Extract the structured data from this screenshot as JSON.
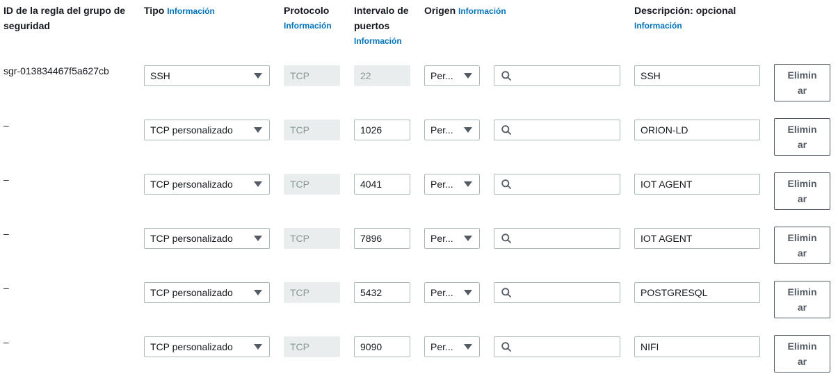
{
  "headers": {
    "rule_id": "ID de la regla del grupo de seguridad",
    "type": "Tipo",
    "protocol": "Protocolo",
    "port_range": "Intervalo de puertos",
    "source": "Origen",
    "description": "Descripción: opcional",
    "info_link": "Información"
  },
  "rows": [
    {
      "id": "sgr-013834467f5a627cb",
      "type": "SSH",
      "protocol": "TCP",
      "port": "22",
      "source": "Per...",
      "search": "",
      "description": "SSH",
      "delete_label": "Eliminar"
    },
    {
      "id": "–",
      "type": "TCP personalizado",
      "protocol": "TCP",
      "port": "1026",
      "source": "Per...",
      "search": "",
      "description": "ORION-LD",
      "delete_label": "Eliminar"
    },
    {
      "id": "–",
      "type": "TCP personalizado",
      "protocol": "TCP",
      "port": "4041",
      "source": "Per...",
      "search": "",
      "description": "IOT AGENT",
      "delete_label": "Eliminar"
    },
    {
      "id": "–",
      "type": "TCP personalizado",
      "protocol": "TCP",
      "port": "7896",
      "source": "Per...",
      "search": "",
      "description": "IOT AGENT",
      "delete_label": "Eliminar"
    },
    {
      "id": "–",
      "type": "TCP personalizado",
      "protocol": "TCP",
      "port": "5432",
      "source": "Per...",
      "search": "",
      "description": "POSTGRESQL",
      "delete_label": "Eliminar"
    },
    {
      "id": "–",
      "type": "TCP personalizado",
      "protocol": "TCP",
      "port": "9090",
      "source": "Per...",
      "search": "",
      "description": "NIFI",
      "delete_label": "Eliminar"
    }
  ],
  "icons": {
    "search": "search-icon",
    "dropdown": "chevron-down-icon"
  },
  "colors": {
    "link": "#0073bb",
    "border": "#aab7b8",
    "disabled_bg": "#eaeded",
    "button_border": "#545b64"
  }
}
